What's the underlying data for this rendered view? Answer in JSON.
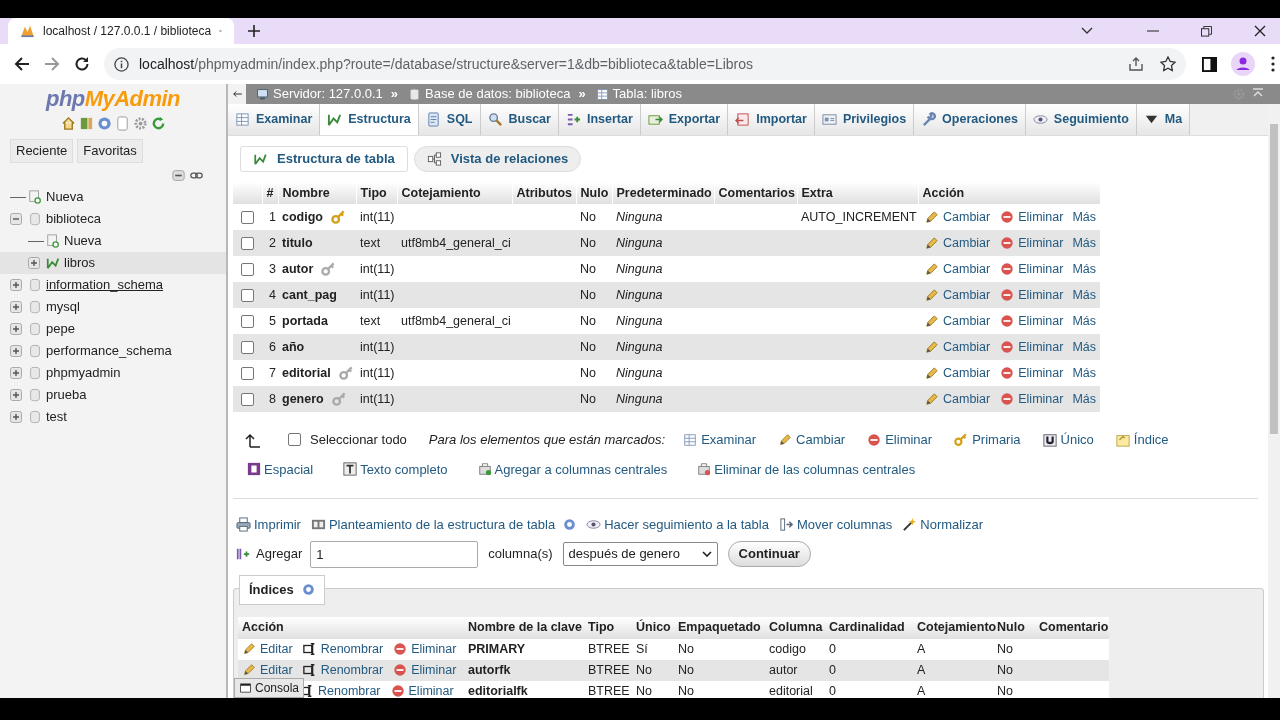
{
  "browser": {
    "tab_title": "localhost / 127.0.0.1 / biblioteca",
    "url_host": "localhost",
    "url_path": "/phpmyadmin/index.php?route=/database/structure&server=1&db=biblioteca&table=Libros"
  },
  "sidebar": {
    "logo_php": "php",
    "logo_myadmin": "MyAdmin",
    "tabs": [
      {
        "label": "Reciente",
        "selected": false
      },
      {
        "label": "Favoritas",
        "selected": false
      }
    ],
    "tree": [
      {
        "label": "Nueva",
        "kind": "new",
        "selected": false,
        "underlined": false
      },
      {
        "label": "biblioteca",
        "kind": "database",
        "expanded": true,
        "selected": false,
        "underlined": false,
        "children": [
          {
            "label": "Nueva",
            "kind": "new",
            "selected": false,
            "underlined": false
          },
          {
            "label": "libros",
            "kind": "table",
            "expanded": false,
            "selected": true,
            "underlined": false
          }
        ]
      },
      {
        "label": "information_schema",
        "kind": "database",
        "expanded": false,
        "selected": false,
        "underlined": true
      },
      {
        "label": "mysql",
        "kind": "database",
        "expanded": false,
        "selected": false,
        "underlined": false
      },
      {
        "label": "pepe",
        "kind": "database",
        "expanded": false,
        "selected": false,
        "underlined": false
      },
      {
        "label": "performance_schema",
        "kind": "database",
        "expanded": false,
        "selected": false,
        "underlined": false
      },
      {
        "label": "phpmyadmin",
        "kind": "database",
        "expanded": false,
        "selected": false,
        "underlined": false
      },
      {
        "label": "prueba",
        "kind": "database",
        "expanded": false,
        "selected": false,
        "underlined": false
      },
      {
        "label": "test",
        "kind": "database",
        "expanded": false,
        "selected": false,
        "underlined": false
      }
    ]
  },
  "breadcrumb": [
    "Servidor: 127.0.0.1",
    "»",
    "Base de datos: biblioteca",
    "»",
    "Tabla: libros"
  ],
  "tabs": [
    {
      "label": "Examinar",
      "selected": false
    },
    {
      "label": "Estructura",
      "selected": true
    },
    {
      "label": "SQL",
      "selected": false
    },
    {
      "label": "Buscar",
      "selected": false
    },
    {
      "label": "Insertar",
      "selected": false
    },
    {
      "label": "Exportar",
      "selected": false
    },
    {
      "label": "Importar",
      "selected": false
    },
    {
      "label": "Privilegios",
      "selected": false
    },
    {
      "label": "Operaciones",
      "selected": false
    },
    {
      "label": "Seguimiento",
      "selected": false
    },
    {
      "label": "Ma",
      "selected": false
    }
  ],
  "subtabs": [
    {
      "label": "Estructura de tabla",
      "selected": true
    },
    {
      "label": "Vista de relaciones",
      "selected": false
    }
  ],
  "structure": {
    "columns": [
      "#",
      "Nombre",
      "Tipo",
      "Cotejamiento",
      "Atributos",
      "Nulo",
      "Predeterminado",
      "Comentarios",
      "Extra",
      "Acción"
    ],
    "rows": [
      {
        "checked": false,
        "num": "1",
        "name": "codigo",
        "kind": "primary_key",
        "type": "int(11)",
        "collation": "",
        "null": "No",
        "default": "Ninguna",
        "extra": "AUTO_INCREMENT",
        "actions": [
          "Cambiar",
          "Eliminar",
          "Más"
        ]
      },
      {
        "checked": false,
        "num": "2",
        "name": "titulo",
        "kind": "plain",
        "type": "text",
        "collation": "utf8mb4_general_ci",
        "null": "No",
        "default": "Ninguna",
        "extra": "",
        "actions": [
          "Cambiar",
          "Eliminar",
          "Más"
        ]
      },
      {
        "checked": false,
        "num": "3",
        "name": "autor",
        "kind": "foreign_key",
        "type": "int(11)",
        "collation": "",
        "null": "No",
        "default": "Ninguna",
        "extra": "",
        "actions": [
          "Cambiar",
          "Eliminar",
          "Más"
        ]
      },
      {
        "checked": false,
        "num": "4",
        "name": "cant_pag",
        "kind": "plain",
        "type": "int(11)",
        "collation": "",
        "null": "No",
        "default": "Ninguna",
        "extra": "",
        "actions": [
          "Cambiar",
          "Eliminar",
          "Más"
        ]
      },
      {
        "checked": false,
        "num": "5",
        "name": "portada",
        "kind": "plain",
        "type": "text",
        "collation": "utf8mb4_general_ci",
        "null": "No",
        "default": "Ninguna",
        "extra": "",
        "actions": [
          "Cambiar",
          "Eliminar",
          "Más"
        ]
      },
      {
        "checked": false,
        "num": "6",
        "name": "año",
        "kind": "plain",
        "type": "int(11)",
        "collation": "",
        "null": "No",
        "default": "Ninguna",
        "extra": "",
        "actions": [
          "Cambiar",
          "Eliminar",
          "Más"
        ]
      },
      {
        "checked": false,
        "num": "7",
        "name": "editorial",
        "kind": "foreign_key",
        "type": "int(11)",
        "collation": "",
        "null": "No",
        "default": "Ninguna",
        "extra": "",
        "actions": [
          "Cambiar",
          "Eliminar",
          "Más"
        ]
      },
      {
        "checked": false,
        "num": "8",
        "name": "genero",
        "kind": "foreign_key",
        "type": "int(11)",
        "collation": "",
        "null": "No",
        "default": "Ninguna",
        "extra": "",
        "actions": [
          "Cambiar",
          "Eliminar",
          "Más"
        ]
      }
    ]
  },
  "bulk": {
    "select_all": {
      "label": "Seleccionar todo",
      "checked": false
    },
    "marked_label": "Para los elementos que están marcados:",
    "actions": [
      "Examinar",
      "Cambiar",
      "Eliminar",
      "Primaria",
      "Único",
      "Índice",
      "Espacial",
      "Texto completo",
      "Agregar a columnas centrales",
      "Eliminar de las columnas centrales"
    ]
  },
  "tools": [
    "Imprimir",
    "Planteamiento de la estructura de tabla",
    "Hacer seguimiento a la tabla",
    "Mover columnas",
    "Normalizar"
  ],
  "add_columns": {
    "label": "Agregar",
    "value": "1",
    "unit": "columna(s)",
    "position": "después de genero",
    "button": "Continuar"
  },
  "indexes": {
    "legend": "Índices",
    "columns": [
      "Acción",
      "Nombre de la clave",
      "Tipo",
      "Único",
      "Empaquetado",
      "Columna",
      "Cardinalidad",
      "Cotejamiento",
      "Nulo",
      "Comentario"
    ],
    "rows": [
      {
        "actions": [
          {
            "kind": "edit",
            "label": "Editar"
          },
          {
            "kind": "rename",
            "label": "Renombrar"
          },
          {
            "kind": "drop",
            "label": "Eliminar"
          }
        ],
        "name": "PRIMARY",
        "type": "BTREE",
        "unique": "Sí",
        "packed": "No",
        "column": "codigo",
        "cardinality": "0",
        "collation": "A",
        "null": "No"
      },
      {
        "actions": [
          {
            "kind": "edit",
            "label": "Editar"
          },
          {
            "kind": "rename",
            "label": "Renombrar"
          },
          {
            "kind": "drop",
            "label": "Eliminar"
          }
        ],
        "name": "autorfk",
        "type": "BTREE",
        "unique": "No",
        "packed": "No",
        "column": "autor",
        "cardinality": "0",
        "collation": "A",
        "null": "No"
      },
      {
        "actions": [
          {
            "kind": "rename",
            "label": "Renombrar"
          },
          {
            "kind": "drop",
            "label": "Eliminar"
          }
        ],
        "name": "editorialfk",
        "type": "BTREE",
        "unique": "No",
        "packed": "No",
        "column": "editorial",
        "cardinality": "0",
        "collation": "A",
        "null": "No"
      }
    ]
  },
  "console": "Consola"
}
